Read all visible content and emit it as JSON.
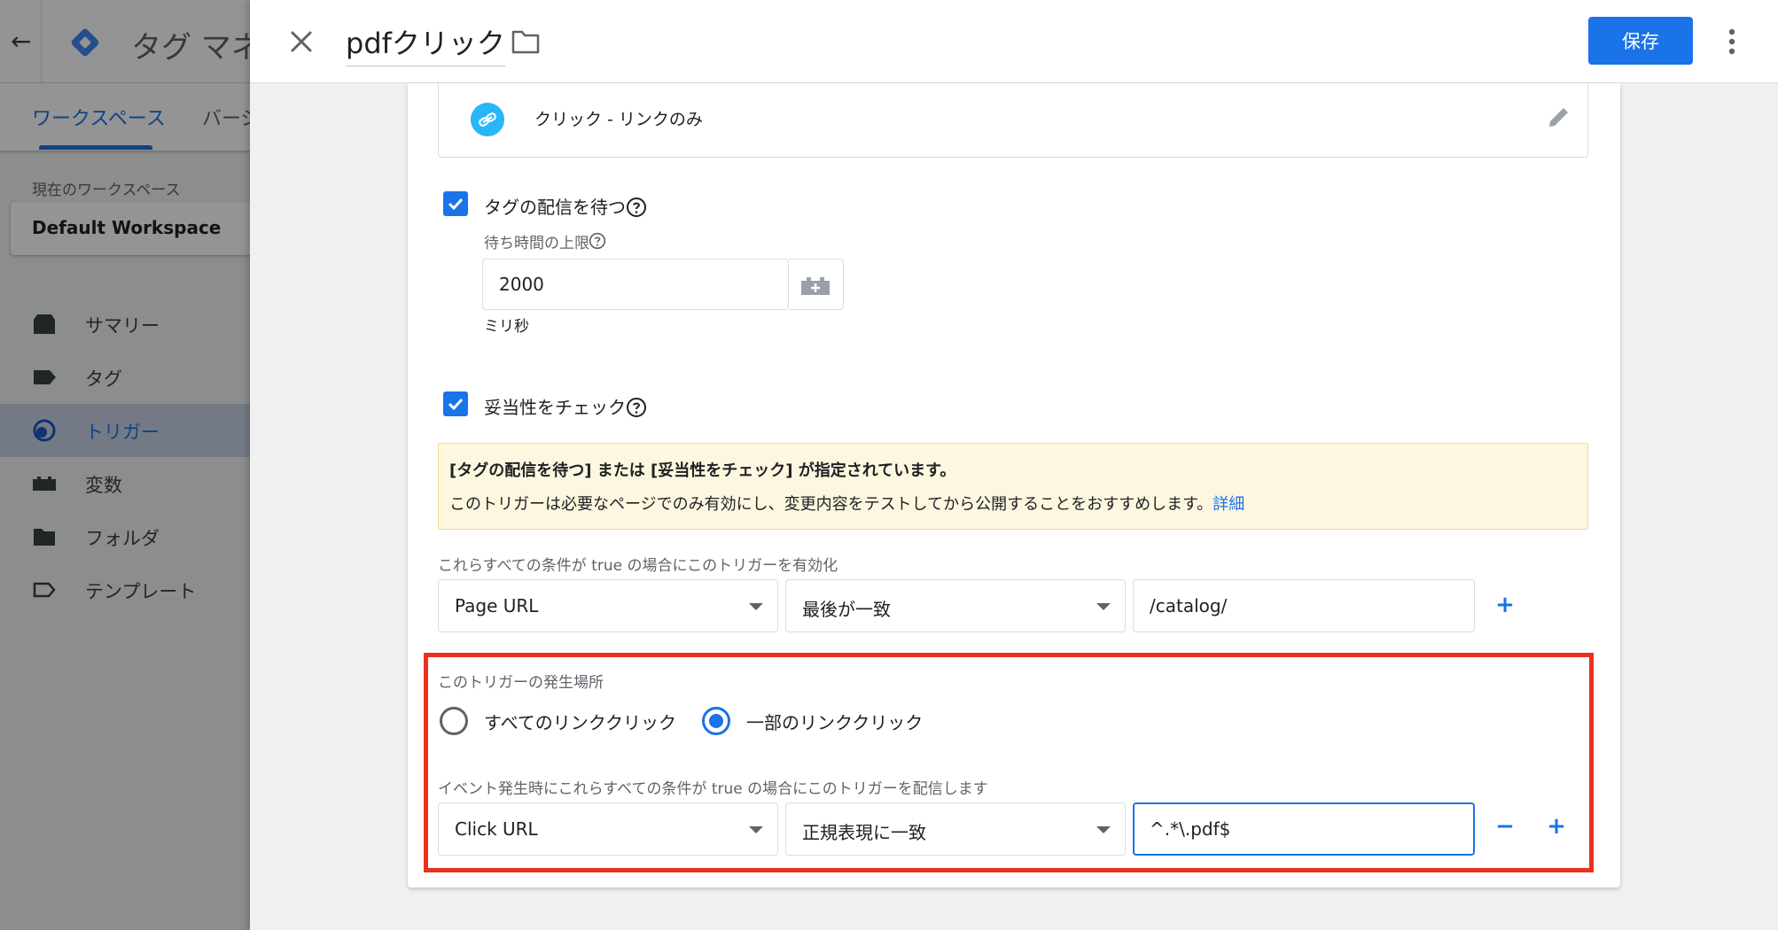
{
  "background": {
    "app_title": "タグ マネ",
    "tabs": [
      "ワークスペース",
      "バージ"
    ],
    "workspace_label": "現在のワークスペース",
    "workspace_name": "Default Workspace",
    "nav": [
      {
        "label": "サマリー",
        "icon": "summary-icon"
      },
      {
        "label": "タグ",
        "icon": "tag-icon"
      },
      {
        "label": "トリガー",
        "icon": "trigger-icon",
        "active": true
      },
      {
        "label": "変数",
        "icon": "variable-icon"
      },
      {
        "label": "フォルダ",
        "icon": "folder-icon"
      },
      {
        "label": "テンプレート",
        "icon": "template-icon"
      }
    ]
  },
  "header": {
    "title": "pdfクリック",
    "save_label": "保存"
  },
  "trigger_type": {
    "label": "クリック - リンクのみ"
  },
  "wait_for_tags": {
    "label": "タグの配信を待つ",
    "checked": true,
    "timeout_label": "待ち時間の上限",
    "timeout_value": "2000",
    "unit": "ミリ秒"
  },
  "check_validation": {
    "label": "妥当性をチェック",
    "checked": true
  },
  "notice": {
    "title": "[タグの配信を待つ] または [妥当性をチェック] が指定されています。",
    "body": "このトリガーは必要なページでのみ有効にし、変更内容をテストしてから公開することをおすすめします。",
    "link": "詳細"
  },
  "enable_conditions": {
    "label": "これらすべての条件が true の場合にこのトリガーを有効化",
    "variable": "Page URL",
    "operator": "最後が一致",
    "value": "/catalog/"
  },
  "fires_on": {
    "label": "このトリガーの発生場所",
    "options": [
      "すべてのリンククリック",
      "一部のリンククリック"
    ],
    "selected": "一部のリンククリック",
    "conditions_label": "イベント発生時にこれらすべての条件が true の場合にこのトリガーを配信します",
    "variable": "Click URL",
    "operator": "正規表現に一致",
    "value": "^.*\\.pdf$"
  },
  "colors": {
    "accent": "#1a73e8",
    "highlight": "#e8311e",
    "notice_bg": "#fef7e0"
  }
}
